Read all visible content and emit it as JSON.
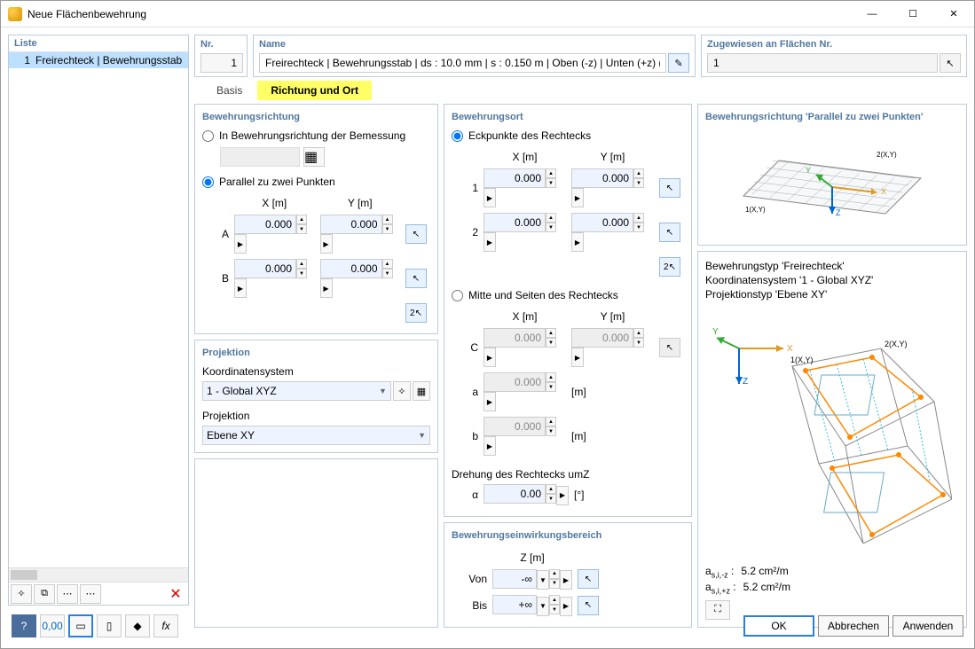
{
  "window": {
    "title": "Neue Flächenbewehrung"
  },
  "header": {
    "nr_label": "Nr.",
    "nr_value": "1",
    "name_label": "Name",
    "name_value": "Freirechteck | Bewehrungsstab | ds : 10.0 mm | s : 0.150 m | Oben (-z) | Unten (+z) (Fläc",
    "assign_label": "Zugewiesen an Flächen Nr.",
    "assign_value": "1"
  },
  "list": {
    "header": "Liste",
    "items": [
      {
        "num": "1",
        "text": "Freirechteck | Bewehrungsstab"
      }
    ]
  },
  "tabs": {
    "basis": "Basis",
    "direction": "Richtung und Ort"
  },
  "direction_group": {
    "title": "Bewehrungsrichtung",
    "opt1": "In Bewehrungsrichtung der Bemessung",
    "opt2": "Parallel zu zwei Punkten",
    "xh": "X [m]",
    "yh": "Y [m]",
    "rowA": "A",
    "rowB": "B",
    "ax": "0.000",
    "ay": "0.000",
    "bx": "0.000",
    "by": "0.000"
  },
  "projection_group": {
    "title": "Projektion",
    "coord_label": "Koordinatensystem",
    "coord_value": "1 - Global XYZ",
    "proj_label": "Projektion",
    "proj_value": "Ebene XY"
  },
  "location_group": {
    "title": "Bewehrungsort",
    "opt_corners": "Eckpunkte des Rechtecks",
    "opt_center": "Mitte und Seiten des Rechtecks",
    "xh": "X [m]",
    "yh": "Y [m]",
    "r1": "1",
    "r2": "2",
    "x1": "0.000",
    "y1": "0.000",
    "x2": "0.000",
    "y2": "0.000",
    "rC": "C",
    "ra": "a",
    "rb": "b",
    "cx": "0.000",
    "cy": "0.000",
    "aval": "0.000",
    "bval": "0.000",
    "unit_m": "[m]",
    "rot_label": "Drehung des Rechtecks umZ",
    "alpha": "α",
    "alpha_val": "0.00",
    "unit_deg": "[°]"
  },
  "effect_group": {
    "title": "Bewehrungseinwirkungsbereich",
    "zh": "Z [m]",
    "von": "Von",
    "bis": "Bis",
    "vonv": "-∞",
    "bisv": "+∞"
  },
  "preview1": {
    "title": "Bewehrungsrichtung 'Parallel zu zwei Punkten'"
  },
  "preview2": {
    "line1": "Bewehrungstyp 'Freirechteck'",
    "line2": "Koordinatensystem '1 - Global XYZ'",
    "line3": "Projektionstyp 'Ebene XY'",
    "res1_label": "as,i,-z :",
    "res1_val": "5.2 cm²/m",
    "res2_label": "as,i,+z :",
    "res2_val": "5.2 cm²/m"
  },
  "buttons": {
    "ok": "OK",
    "cancel": "Abbrechen",
    "apply": "Anwenden"
  }
}
